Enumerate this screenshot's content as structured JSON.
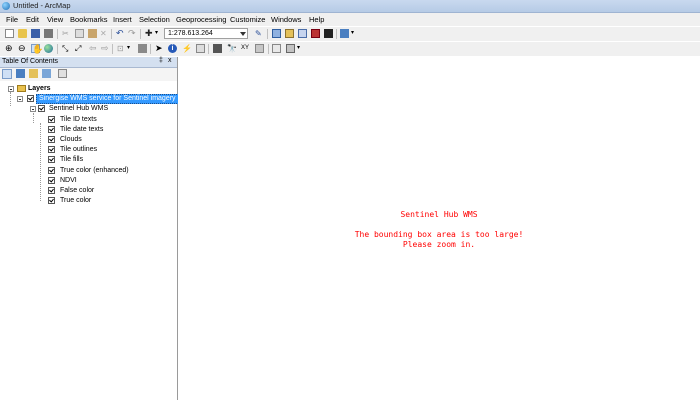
{
  "window": {
    "title": "Untitled - ArcMap"
  },
  "menu": [
    "File",
    "Edit",
    "View",
    "Bookmarks",
    "Insert",
    "Selection",
    "Geoprocessing",
    "Customize",
    "Windows",
    "Help"
  ],
  "toolbar": {
    "scale_value": "1:278.613.264"
  },
  "toc": {
    "title": "Table Of Contents",
    "pin": "‡",
    "close": "x",
    "root": "Layers",
    "service": "Sinergise WMS service for Sentinel imagery",
    "group": "Sentinel Hub WMS",
    "layers": [
      "Tile ID texts",
      "Tile date texts",
      "Clouds",
      "Tile outlines",
      "Tile fills",
      "True color (enhanced)",
      "NDVI",
      "False color",
      "True color"
    ]
  },
  "map": {
    "line1": "Sentinel Hub WMS",
    "line2": "The bounding box area is too large!",
    "line3": "Please zoom in."
  },
  "colors": {
    "message": "#ff0000",
    "selection": "#3399ff"
  }
}
